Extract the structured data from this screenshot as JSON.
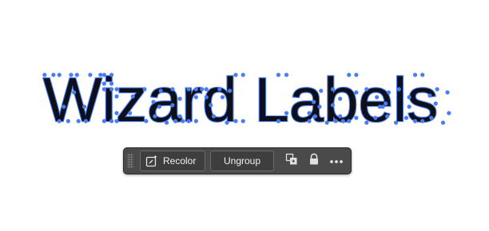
{
  "canvas": {
    "text_object": "Wizard Labels"
  },
  "context_toolbar": {
    "recolor_label": "Recolor",
    "ungroup_label": "Ungroup",
    "icons": [
      "grip-handle-icon",
      "recolor-icon",
      "arrange-icon",
      "lock-icon",
      "more-options-icon"
    ]
  },
  "colors": {
    "selection_accent": "#4a7df0",
    "text_fill": "#0d0f1a",
    "toolbar_bg": "#4a4a4a"
  }
}
